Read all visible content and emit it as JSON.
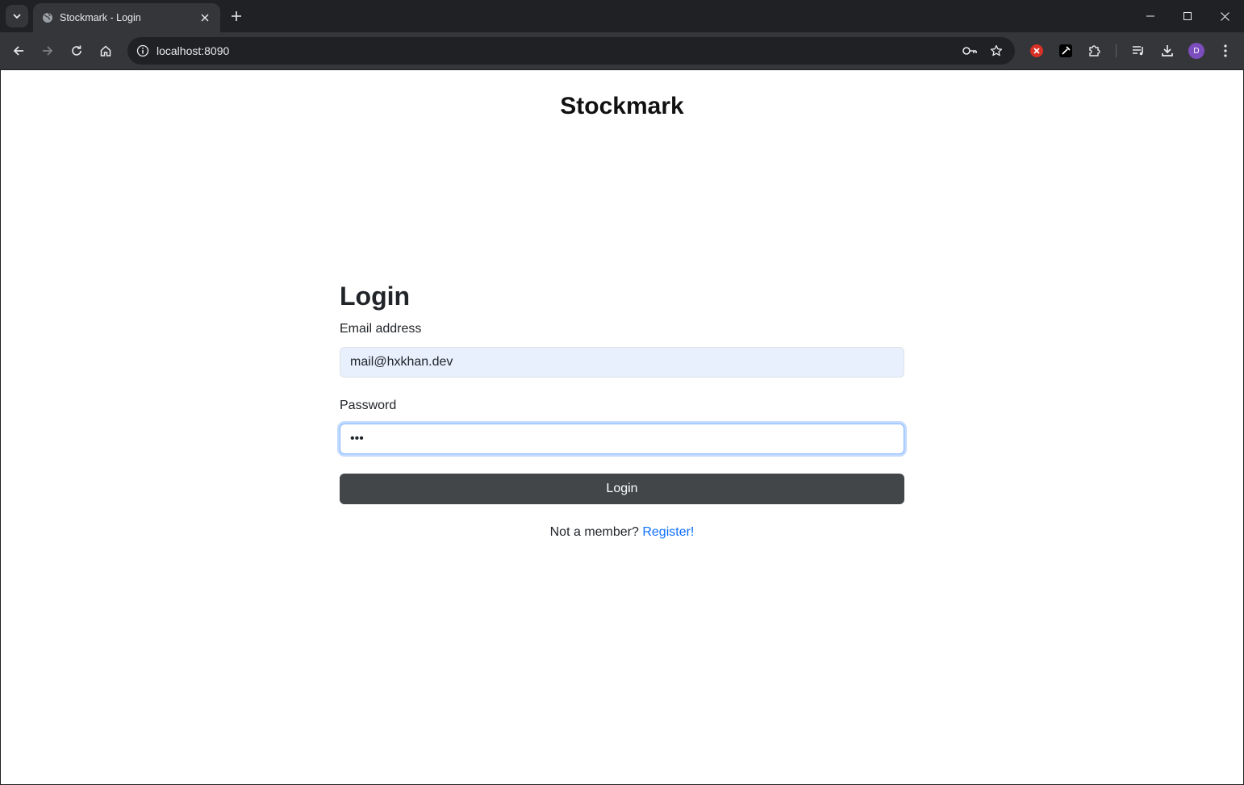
{
  "browser": {
    "tab_title": "Stockmark - Login",
    "url": "localhost:8090",
    "profile_initial": "D"
  },
  "page": {
    "brand": "Stockmark",
    "form_title": "Login",
    "email_label": "Email address",
    "email_value": "mail@hxkhan.dev",
    "password_label": "Password",
    "password_value": "•••",
    "submit_label": "Login",
    "register_prompt": "Not a member?",
    "register_link": "Register!"
  },
  "icons": {
    "tab_search": "chevron-down-icon",
    "favicon": "globe-icon",
    "tab_close": "close-icon",
    "new_tab": "plus-icon",
    "back": "arrow-left-icon",
    "forward": "arrow-right-icon",
    "reload": "reload-icon",
    "home": "home-icon",
    "site_info": "info-icon",
    "password_manager": "key-icon",
    "bookmark": "star-icon",
    "extension_red": "red-x-extension-icon",
    "eyedropper": "eyedropper-icon",
    "extensions": "puzzle-icon",
    "media": "media-playlist-icon",
    "downloads": "download-icon",
    "menu": "more-vert-icon"
  },
  "colors": {
    "chrome_dark": "#202124",
    "chrome_toolbar": "#35363a",
    "button_dark": "#424649",
    "link_blue": "#0d6efd",
    "autofill_bg": "#e8f0fe",
    "avatar_purple": "#7c4dbd"
  }
}
